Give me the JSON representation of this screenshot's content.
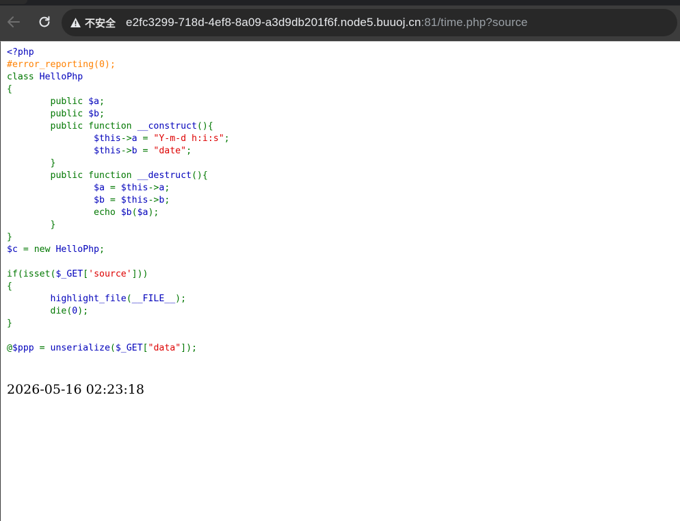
{
  "browser": {
    "security_label": "不安全",
    "url_host": "e2fc3299-718d-4ef8-8a09-a3d9db201f6f.node5.buuoj.cn",
    "url_rest": ":81/time.php?source",
    "icons": {
      "back": "back-arrow-icon",
      "reload": "reload-icon",
      "warning": "warning-triangle-icon"
    }
  },
  "code": {
    "lines": [
      [
        {
          "t": "<?php",
          "c": "d"
        }
      ],
      [
        {
          "t": "#error_reporting(0);",
          "c": "c"
        }
      ],
      [
        {
          "t": "class ",
          "c": "k"
        },
        {
          "t": "HelloPhp",
          "c": "d"
        }
      ],
      [
        {
          "t": "{",
          "c": "k"
        }
      ],
      [
        {
          "t": "        public ",
          "c": "k"
        },
        {
          "t": "$a",
          "c": "d"
        },
        {
          "t": ";",
          "c": "k"
        }
      ],
      [
        {
          "t": "        public ",
          "c": "k"
        },
        {
          "t": "$b",
          "c": "d"
        },
        {
          "t": ";",
          "c": "k"
        }
      ],
      [
        {
          "t": "        public function ",
          "c": "k"
        },
        {
          "t": "__construct",
          "c": "d"
        },
        {
          "t": "(){",
          "c": "k"
        }
      ],
      [
        {
          "t": "                ",
          "c": "k"
        },
        {
          "t": "$this",
          "c": "d"
        },
        {
          "t": "->",
          "c": "k"
        },
        {
          "t": "a ",
          "c": "d"
        },
        {
          "t": "= ",
          "c": "k"
        },
        {
          "t": "\"Y-m-d h:i:s\"",
          "c": "s"
        },
        {
          "t": ";",
          "c": "k"
        }
      ],
      [
        {
          "t": "                ",
          "c": "k"
        },
        {
          "t": "$this",
          "c": "d"
        },
        {
          "t": "->",
          "c": "k"
        },
        {
          "t": "b ",
          "c": "d"
        },
        {
          "t": "= ",
          "c": "k"
        },
        {
          "t": "\"date\"",
          "c": "s"
        },
        {
          "t": ";",
          "c": "k"
        }
      ],
      [
        {
          "t": "        }",
          "c": "k"
        }
      ],
      [
        {
          "t": "        public function ",
          "c": "k"
        },
        {
          "t": "__destruct",
          "c": "d"
        },
        {
          "t": "(){",
          "c": "k"
        }
      ],
      [
        {
          "t": "                ",
          "c": "k"
        },
        {
          "t": "$a ",
          "c": "d"
        },
        {
          "t": "= ",
          "c": "k"
        },
        {
          "t": "$this",
          "c": "d"
        },
        {
          "t": "->",
          "c": "k"
        },
        {
          "t": "a",
          "c": "d"
        },
        {
          "t": ";",
          "c": "k"
        }
      ],
      [
        {
          "t": "                ",
          "c": "k"
        },
        {
          "t": "$b ",
          "c": "d"
        },
        {
          "t": "= ",
          "c": "k"
        },
        {
          "t": "$this",
          "c": "d"
        },
        {
          "t": "->",
          "c": "k"
        },
        {
          "t": "b",
          "c": "d"
        },
        {
          "t": ";",
          "c": "k"
        }
      ],
      [
        {
          "t": "                echo ",
          "c": "k"
        },
        {
          "t": "$b",
          "c": "d"
        },
        {
          "t": "(",
          "c": "k"
        },
        {
          "t": "$a",
          "c": "d"
        },
        {
          "t": ");",
          "c": "k"
        }
      ],
      [
        {
          "t": "        }",
          "c": "k"
        }
      ],
      [
        {
          "t": "}",
          "c": "k"
        }
      ],
      [
        {
          "t": "$c ",
          "c": "d"
        },
        {
          "t": "= new ",
          "c": "k"
        },
        {
          "t": "HelloPhp",
          "c": "d"
        },
        {
          "t": ";",
          "c": "k"
        }
      ],
      [
        {
          "t": "",
          "c": "k"
        }
      ],
      [
        {
          "t": "if(isset(",
          "c": "k"
        },
        {
          "t": "$_GET",
          "c": "d"
        },
        {
          "t": "[",
          "c": "k"
        },
        {
          "t": "'source'",
          "c": "s"
        },
        {
          "t": "]))",
          "c": "k"
        }
      ],
      [
        {
          "t": "{",
          "c": "k"
        }
      ],
      [
        {
          "t": "        ",
          "c": "k"
        },
        {
          "t": "highlight_file",
          "c": "d"
        },
        {
          "t": "(",
          "c": "k"
        },
        {
          "t": "__FILE__",
          "c": "d"
        },
        {
          "t": ");",
          "c": "k"
        }
      ],
      [
        {
          "t": "        die(",
          "c": "k"
        },
        {
          "t": "0",
          "c": "d"
        },
        {
          "t": ");",
          "c": "k"
        }
      ],
      [
        {
          "t": "}",
          "c": "k"
        }
      ],
      [
        {
          "t": "",
          "c": "k"
        }
      ],
      [
        {
          "t": "@",
          "c": "k"
        },
        {
          "t": "$ppp ",
          "c": "d"
        },
        {
          "t": "= ",
          "c": "k"
        },
        {
          "t": "unserialize",
          "c": "d"
        },
        {
          "t": "(",
          "c": "k"
        },
        {
          "t": "$_GET",
          "c": "d"
        },
        {
          "t": "[",
          "c": "k"
        },
        {
          "t": "\"data\"",
          "c": "s"
        },
        {
          "t": "]);",
          "c": "k"
        }
      ]
    ]
  },
  "output_text": "2026-05-16 02:23:18"
}
